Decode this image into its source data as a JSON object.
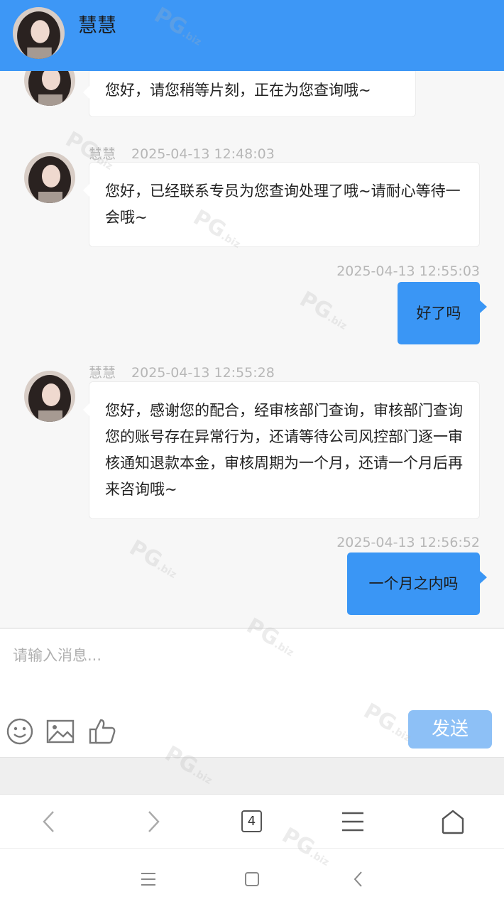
{
  "header": {
    "title": "慧慧"
  },
  "messages": [
    {
      "text": "您好，请您稍等片刻，正在为您查询哦~"
    },
    {
      "name": "慧慧",
      "time": "2025-04-13 12:48:03",
      "text": "您好，已经联系专员为您查询处理了哦~请耐心等待一会哦~"
    },
    {
      "time": "2025-04-13 12:55:03",
      "text": "好了吗"
    },
    {
      "name": "慧慧",
      "time": "2025-04-13 12:55:28",
      "text": "您好，感谢您的配合，经审核部门查询，审核部门查询您的账号存在异常行为，还请等待公司风控部门逐一审核通知退款本金，审核周期为一个月，还请一个月后再来咨询哦~"
    },
    {
      "time": "2025-04-13 12:56:52",
      "text": "一个月之内吗"
    }
  ],
  "input": {
    "placeholder": "请输入消息...",
    "value": ""
  },
  "toolbar": {
    "icons": [
      "smiley-icon",
      "image-icon",
      "thumbs-up-icon"
    ],
    "send_label": "发送"
  },
  "browser_nav": {
    "tab_count": "4"
  },
  "watermark": {
    "brand": "PG",
    "suffix": ".biz"
  },
  "colors": {
    "header": "#3d97f6",
    "outgoing_bubble": "#3a96f5",
    "send_button": "#8dc0f6"
  }
}
